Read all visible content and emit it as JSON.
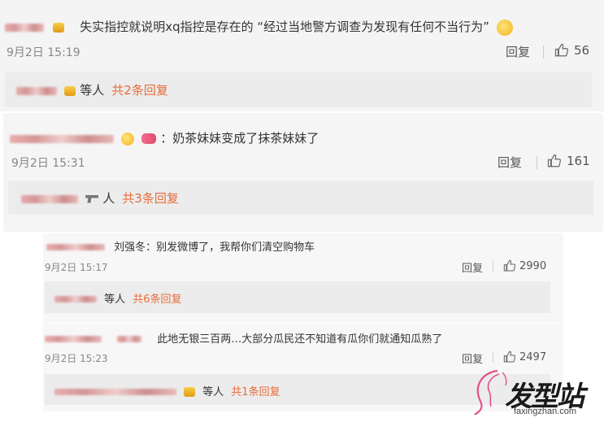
{
  "comments": [
    {
      "text": "失实指控就说明xq指控是存在的 “经过当地警方调查为发现有任何不当行为”",
      "time": "9月2日 15:19",
      "reply_label": "回复",
      "likes": "56",
      "sub_prefix": "等人",
      "sub_count": "共2条回复"
    },
    {
      "text": "：奶茶妹妹变成了抹茶妹妹了",
      "time": "9月2日 15:31",
      "reply_label": "回复",
      "likes": "161",
      "sub_prefix": "人",
      "sub_count": "共3条回复"
    },
    {
      "text": "刘强冬：别发微博了，我帮你们清空购物车",
      "time": "9月2日 15:17",
      "reply_label": "回复",
      "likes": "2990",
      "sub_prefix": "等人",
      "sub_count": "共6条回复"
    },
    {
      "text": "此地无银三百两…大部分瓜民还不知道有瓜你们就通知瓜熟了",
      "time": "9月2日 15:23",
      "reply_label": "回复",
      "likes": "2497",
      "sub_prefix": "等人",
      "sub_count": "共1条回复"
    }
  ],
  "icons": {
    "like": "thumbs-up-icon",
    "emoji": "grin-emoji-icon",
    "badge": "vip-badge-icon"
  },
  "colors": {
    "reply_count": "#e86c3a",
    "text": "#333333",
    "meta": "#888888"
  },
  "watermark": {
    "zh": "发型站",
    "en": "faxingzhan.com"
  }
}
